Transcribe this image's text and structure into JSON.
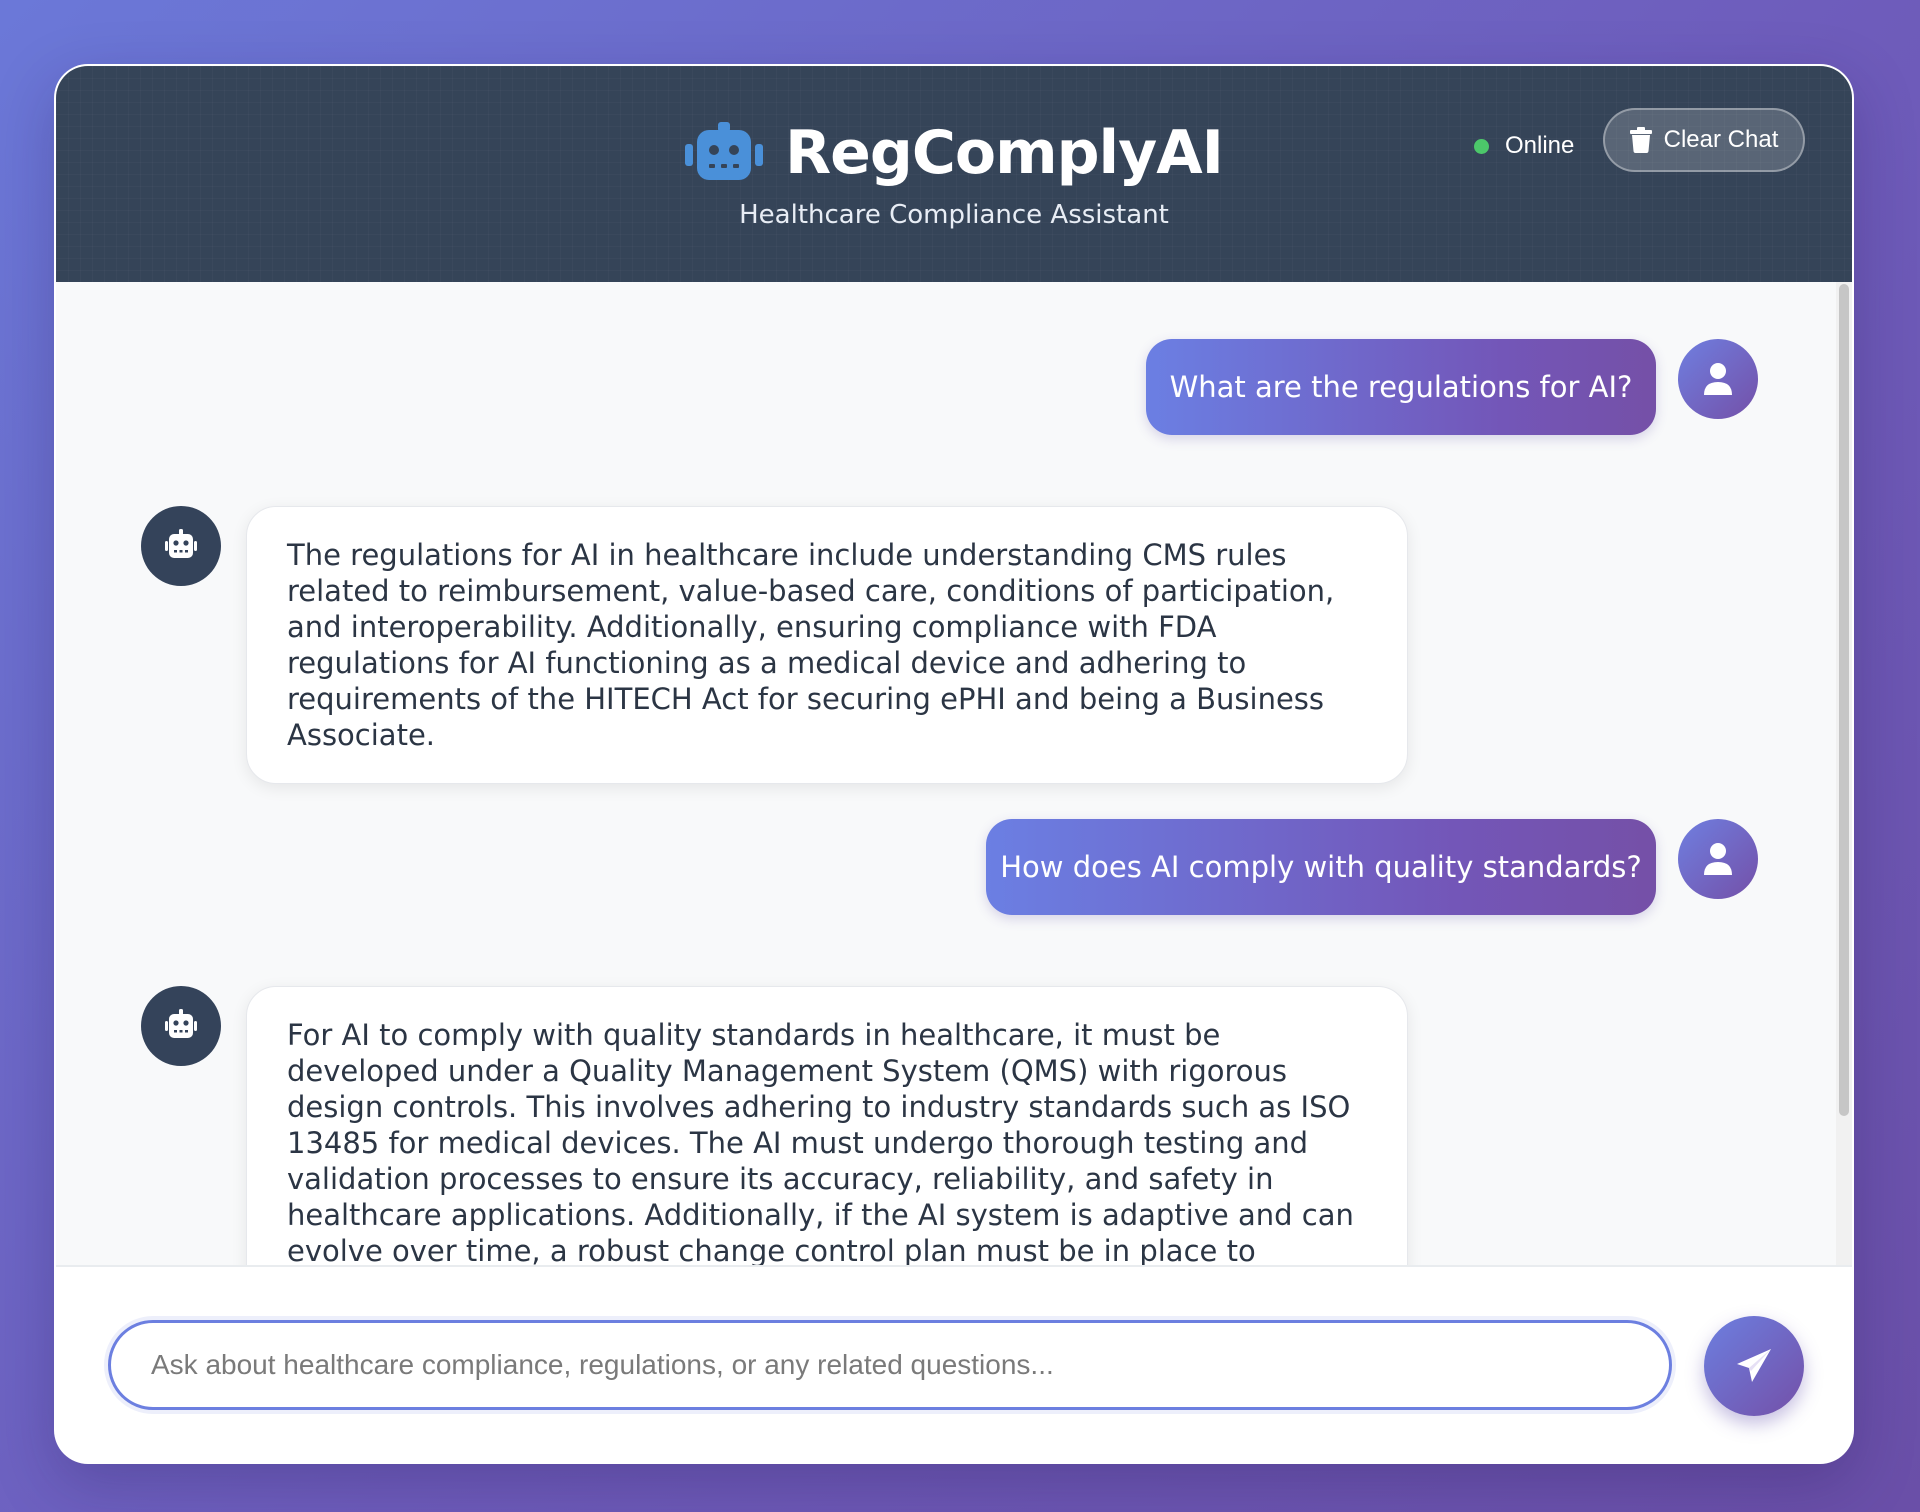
{
  "header": {
    "title": "RegComplyAI",
    "subtitle": "Healthcare Compliance Assistant",
    "status_label": "Online",
    "clear_button_label": "Clear Chat",
    "brand_icon": "robot-icon",
    "clear_icon": "trash-icon"
  },
  "messages": [
    {
      "role": "user",
      "text": "What are the regulations for AI?"
    },
    {
      "role": "bot",
      "text": "The regulations for AI in healthcare include understanding CMS rules related to reimbursement, value-based care, conditions of participation, and interoperability. Additionally, ensuring compliance with FDA regulations for AI functioning as a medical device and adhering to requirements of the HITECH Act for securing ePHI and being a Business Associate."
    },
    {
      "role": "user",
      "text": "How does AI comply with quality standards?"
    },
    {
      "role": "bot",
      "text": "For AI to comply with quality standards in healthcare, it must be developed under a Quality Management System (QMS) with rigorous design controls. This involves adhering to industry standards such as ISO 13485 for medical devices. The AI must undergo thorough testing and validation processes to ensure its accuracy, reliability, and safety in healthcare applications. Additionally, if the AI system is adaptive and can evolve over time, a robust change control plan must be in place to manage updates and modifications while maintaining compliance."
    }
  ],
  "input": {
    "placeholder": "Ask about healthcare compliance, regulations, or any related questions...",
    "value": ""
  },
  "send_icon": "paper-plane-icon",
  "colors": {
    "accent_start": "#6b7fe3",
    "accent_end": "#7450a8",
    "header_bg": "#354458",
    "status_online": "#4cc76a"
  }
}
